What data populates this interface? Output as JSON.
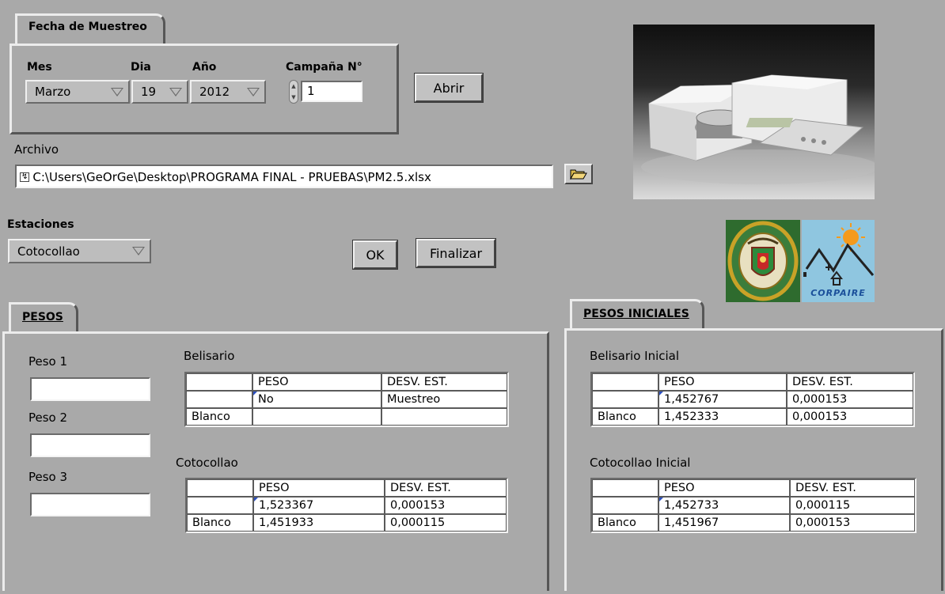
{
  "fecha": {
    "tab_label": "Fecha de Muestreo",
    "mes_label": "Mes",
    "dia_label": "Dia",
    "anio_label": "Año",
    "campana_label": "Campaña N°",
    "mes_value": "Marzo",
    "dia_value": "19",
    "anio_value": "2012",
    "campana_value": "1"
  },
  "abrir_label": "Abrir",
  "archivo": {
    "label": "Archivo",
    "path": "C:\\Users\\GeOrGe\\Desktop\\PROGRAMA FINAL - PRUEBAS\\PM2.5.xlsx",
    "path_icon": "path-icon",
    "browse_icon": "folder-open-icon"
  },
  "estaciones": {
    "label": "Estaciones",
    "value": "Cotocollao"
  },
  "ok_label": "OK",
  "finalizar_label": "Finalizar",
  "pesos": {
    "tab_label": "PESOS",
    "peso1_label": "Peso 1",
    "peso2_label": "Peso 2",
    "peso3_label": "Peso 3",
    "peso1_value": "",
    "peso2_value": "",
    "peso3_value": "",
    "belisario": {
      "title": "Belisario",
      "headers": [
        "",
        "PESO",
        "DESV. EST."
      ],
      "rows": [
        [
          "",
          "No",
          "Muestreo"
        ],
        [
          "Blanco",
          "",
          ""
        ]
      ]
    },
    "cotocollao": {
      "title": "Cotocollao",
      "headers": [
        "",
        "PESO",
        "DESV. EST."
      ],
      "rows": [
        [
          "",
          "1,523367",
          "0,000153"
        ],
        [
          "Blanco",
          "1,451933",
          "0,000115"
        ]
      ]
    }
  },
  "pesos_iniciales": {
    "tab_label": "PESOS INICIALES",
    "belisario": {
      "title": "Belisario Inicial",
      "headers": [
        "",
        "PESO",
        "DESV. EST."
      ],
      "rows": [
        [
          "",
          "1,452767",
          "0,000153"
        ],
        [
          "Blanco",
          "1,452333",
          "0,000153"
        ]
      ]
    },
    "cotocollao": {
      "title": "Cotocollao Inicial",
      "headers": [
        "",
        "PESO",
        "DESV. EST."
      ],
      "rows": [
        [
          "",
          "1,452733",
          "0,000115"
        ],
        [
          "Blanco",
          "1,451967",
          "0,000153"
        ]
      ]
    }
  },
  "logos": {
    "corpaire_text": "CORPAIRE",
    "university_seal_text": "ESCUELA POLITÉCNICA DEL EJÉRCITO · ECUADOR"
  },
  "colors": {
    "background": "#a9a9a9",
    "corpaire_bg": "#8fc6e0",
    "seal_green": "#2e6b2e",
    "seal_gold": "#c9a227"
  }
}
